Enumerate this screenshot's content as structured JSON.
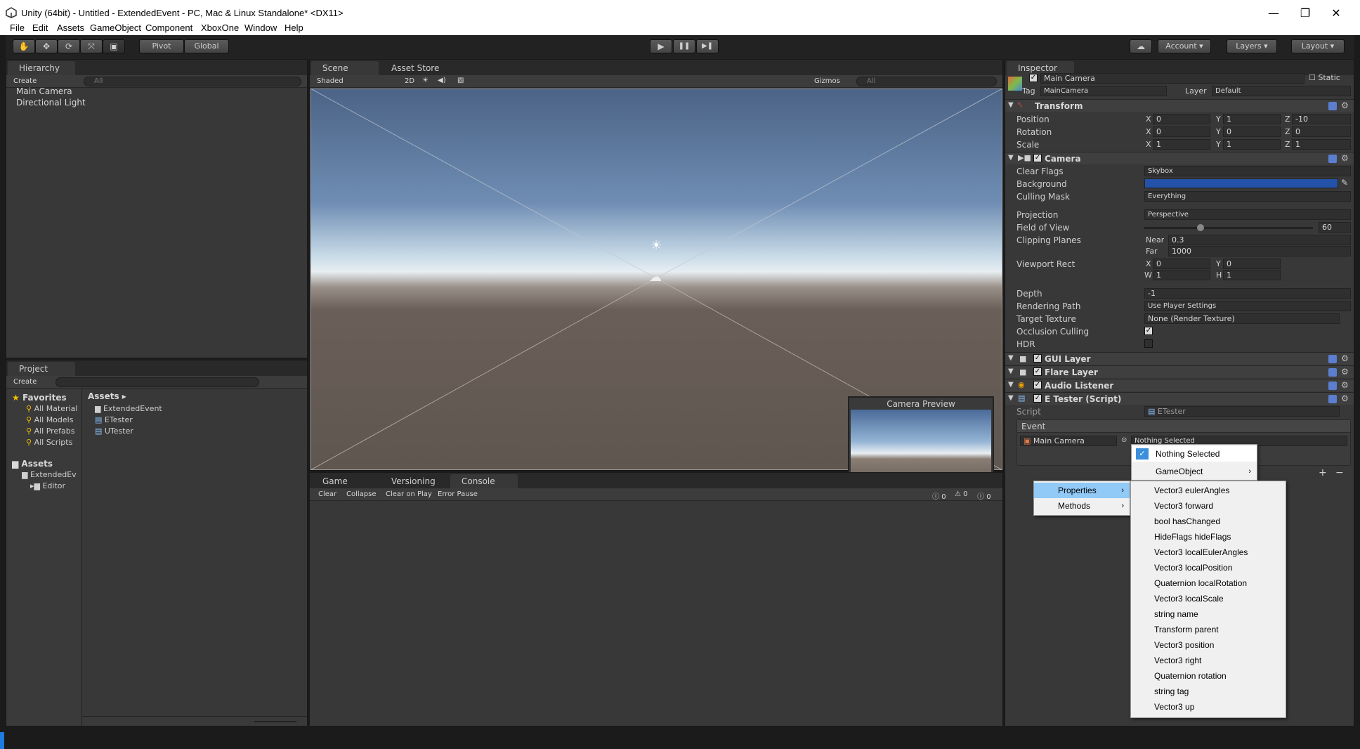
{
  "window": {
    "title": "Unity (64bit) - Untitled - ExtendedEvent - PC, Mac & Linux Standalone* <DX11>",
    "min": "—",
    "max": "❐",
    "close": "✕"
  },
  "menubar": [
    "File",
    "Edit",
    "Assets",
    "GameObject",
    "Component",
    "XboxOne",
    "Window",
    "Help"
  ],
  "toolbar": {
    "pivot": "Pivot",
    "global": "Global",
    "play": "▶",
    "pause": "❚❚",
    "step": "▶❚",
    "account": "Account",
    "layers": "Layers",
    "layout": "Layout"
  },
  "hierarchy": {
    "tab": "Hierarchy",
    "create": "Create",
    "search": "All",
    "items": [
      "Main Camera",
      "Directional Light"
    ]
  },
  "scene": {
    "tabs": [
      "Scene",
      "Asset Store"
    ],
    "shaded": "Shaded",
    "mode2d": "2D",
    "gizmos": "Gizmos",
    "search": "All",
    "camera_preview": "Camera Preview"
  },
  "console": {
    "tabs": [
      "Game",
      "Versioning",
      "Console"
    ],
    "buttons": [
      "Clear",
      "Collapse",
      "Clear on Play",
      "Error Pause"
    ],
    "counts": [
      "0",
      "0",
      "0"
    ]
  },
  "project": {
    "tab": "Project",
    "create": "Create",
    "favorites_label": "Favorites",
    "favorites": [
      "All Material",
      "All Models",
      "All Prefabs",
      "All Scripts"
    ],
    "assets_label": "Assets",
    "tree": [
      "ExtendedEv",
      "Editor"
    ],
    "breadcrumb": "Assets ▸",
    "files": [
      "ExtendedEvent",
      "ETester",
      "UTester"
    ]
  },
  "inspector": {
    "tab": "Inspector",
    "object_name": "Main Camera",
    "static": "Static",
    "tag_label": "Tag",
    "tag": "MainCamera",
    "layer_label": "Layer",
    "layer": "Default",
    "transform": {
      "title": "Transform",
      "rows": [
        {
          "label": "Position",
          "x": "0",
          "y": "1",
          "z": "-10"
        },
        {
          "label": "Rotation",
          "x": "0",
          "y": "0",
          "z": "0"
        },
        {
          "label": "Scale",
          "x": "1",
          "y": "1",
          "z": "1"
        }
      ]
    },
    "camera": {
      "title": "Camera",
      "clear_flags_label": "Clear Flags",
      "clear_flags": "Skybox",
      "background_label": "Background",
      "background_color": "#2452a8",
      "culling_label": "Culling Mask",
      "culling": "Everything",
      "projection_label": "Projection",
      "projection": "Perspective",
      "fov_label": "Field of View",
      "fov": "60",
      "clip_label": "Clipping Planes",
      "near_label": "Near",
      "near": "0.3",
      "far_label": "Far",
      "far": "1000",
      "viewport_label": "Viewport Rect",
      "vx": "0",
      "vy": "0",
      "vw": "1",
      "vh": "1",
      "depth_label": "Depth",
      "depth": "-1",
      "render_label": "Rendering Path",
      "render": "Use Player Settings",
      "target_label": "Target Texture",
      "target": "None (Render Texture)",
      "occlusion_label": "Occlusion Culling",
      "hdr_label": "HDR"
    },
    "components": [
      "GUI Layer",
      "Flare Layer",
      "Audio Listener",
      "E Tester (Script)"
    ],
    "script_label": "Script",
    "script": "ETester",
    "event_label": "Event",
    "event_object": "Main Camera",
    "event_function": "Nothing Selected"
  },
  "menu_main": {
    "items": [
      "Nothing Selected",
      "GameObject"
    ]
  },
  "menu_sub": {
    "items": [
      "Properties",
      "Methods"
    ]
  },
  "menu_props": {
    "items": [
      "Vector3 eulerAngles",
      "Vector3 forward",
      "bool hasChanged",
      "HideFlags hideFlags",
      "Vector3 localEulerAngles",
      "Vector3 localPosition",
      "Quaternion localRotation",
      "Vector3 localScale",
      "string name",
      "Transform parent",
      "Vector3 position",
      "Vector3 right",
      "Quaternion rotation",
      "string tag",
      "Vector3 up"
    ]
  }
}
